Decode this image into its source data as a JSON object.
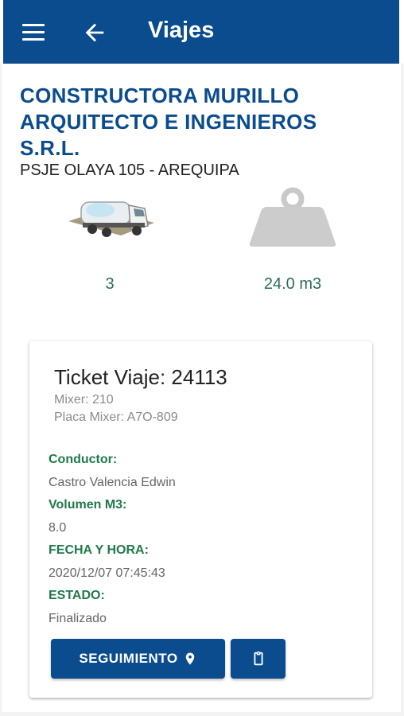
{
  "appbar": {
    "title": "Viajes",
    "menu_icon": "menu-icon",
    "back_icon": "arrow-left-icon",
    "color": "#0a4c8e"
  },
  "company": {
    "name": "CONSTRUCTORA MURILLO ARQUITECTO E INGENIEROS S.R.L.",
    "address": "PSJE OLAYA 105 - AREQUIPA"
  },
  "stats": {
    "trips": {
      "icon": "mixer-truck-icon",
      "value": "3"
    },
    "volume": {
      "icon": "weight-icon",
      "value": "24.0 m3"
    }
  },
  "ticket": {
    "title": "Ticket Viaje: 24113",
    "mixer": "Mixer: 210",
    "plate": "Placa Mixer: A7O-809",
    "fields": [
      {
        "label": "Conductor:",
        "value": "Castro Valencia Edwin"
      },
      {
        "label": "Volumen M3:",
        "value": "8.0"
      },
      {
        "label": "FECHA Y HORA:",
        "value": "2020/12/07 07:45:43"
      },
      {
        "label": "ESTADO:",
        "value": "Finalizado"
      }
    ],
    "actions": {
      "track_label": "SEGUIMIENTO",
      "track_icon": "map-marker-icon",
      "clipboard_icon": "clipboard-icon"
    }
  },
  "colors": {
    "primary": "#0a4c8e",
    "label_green": "#1f7a4a",
    "value_green": "#2e6b5a"
  }
}
